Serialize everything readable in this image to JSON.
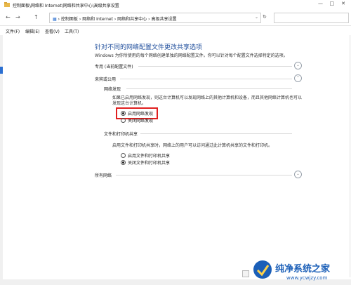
{
  "window": {
    "title": "控制面板\\网络和 Internet\\网络和共享中心\\高级共享设置",
    "controls": [
      "—",
      "□",
      "✕"
    ]
  },
  "address": {
    "back": "←",
    "forward": "→",
    "up": "↑",
    "crumbs": [
      "控制面板",
      "网络和 Internet",
      "网络和共享中心",
      "高级共享设置"
    ],
    "crumb_separator": "›",
    "refresh": "↻"
  },
  "menu": {
    "items": [
      "文件(F)",
      "编辑(E)",
      "查看(V)",
      "工具(T)"
    ]
  },
  "main": {
    "heading": "针对不同的网络配置文件更改共享选项",
    "description": "Windows 为你所使用的每个网络创建单独的网络配置文件。你可以针对每个配置文件选择特定的选项。",
    "sections": {
      "private": {
        "label": "专用 (当前配置文件)",
        "chevron": "⌄"
      },
      "guest": {
        "label": "来宾或公用",
        "chevron": "⌃"
      },
      "all": {
        "label": "所有网络",
        "chevron": "⌄"
      }
    },
    "network_discovery": {
      "title": "网络发现",
      "text": "如果已启用网络发现，则这台计算机可以发现网络上的其他计算机和设备，而且其他网络计算机也可以发现这台计算机。",
      "options": [
        "启用网络发现",
        "关闭网络发现"
      ],
      "selected": 0
    },
    "file_printer_sharing": {
      "title": "文件和打印机共享",
      "text": "启用文件和打印机共享时，网络上的用户可以访问通过此计算机共享的文件和打印机。",
      "options": [
        "启用文件和打印机共享",
        "关闭文件和打印机共享"
      ],
      "selected": 1
    }
  },
  "watermark": {
    "text": "纯净系统之家",
    "url": "www.ycwjzy.com"
  },
  "colors": {
    "heading": "#1f4e9c",
    "highlight": "#e02020",
    "watermark": "#1b5fb8"
  }
}
